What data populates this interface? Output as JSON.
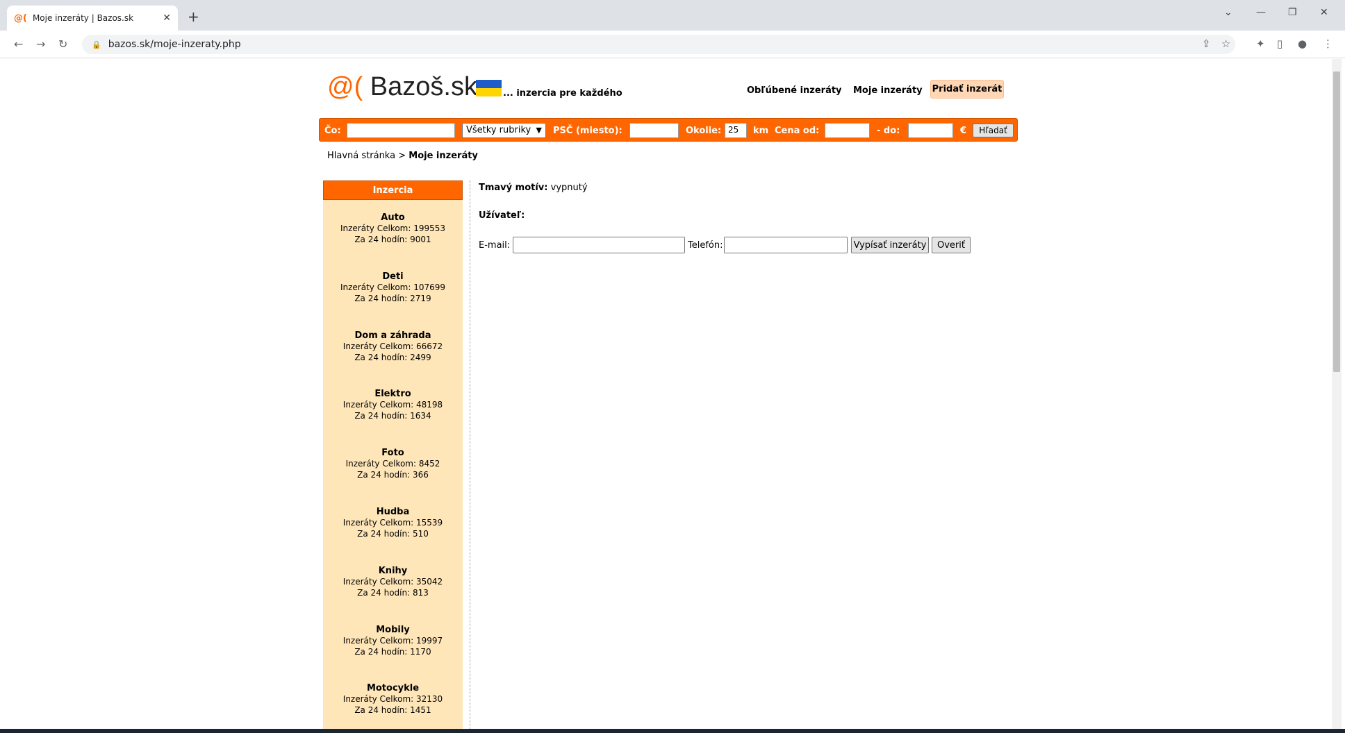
{
  "browser": {
    "tab_title": "Moje inzeráty | Bazos.sk",
    "tab_favicon": "@(",
    "url": "bazos.sk/moje-inzeraty.php"
  },
  "header": {
    "logo_at": "@(",
    "logo_name": " Bazoš.sk",
    "tagline": "... inzercia pre každého",
    "nav_favorites": "Obľúbené inzeráty",
    "nav_my_ads": "Moje inzeráty",
    "nav_add": "Pridať inzerát"
  },
  "search": {
    "what_label": "Čo:",
    "what_value": "",
    "category_selected": "Všetky rubriky",
    "psc_label": "PSČ (miesto):",
    "psc_value": "",
    "radius_label": "Okolie:",
    "radius_value": "25",
    "km_label": "km",
    "price_label": "Cena od:",
    "price_from": "",
    "dash_label": "- do:",
    "price_to": "",
    "currency": "€",
    "search_button": "Hľadať"
  },
  "breadcrumb": {
    "home": "Hlavná stránka",
    "separator": ">",
    "current": "Moje inzeráty"
  },
  "sidebar": {
    "header": "Inzercia",
    "categories": [
      {
        "name": "Auto",
        "total": "Inzeráty Celkom: 199553",
        "day": "Za 24 hodín: 9001"
      },
      {
        "name": "Deti",
        "total": "Inzeráty Celkom: 107699",
        "day": "Za 24 hodín: 2719"
      },
      {
        "name": "Dom a záhrada",
        "total": "Inzeráty Celkom: 66672",
        "day": "Za 24 hodín: 2499"
      },
      {
        "name": "Elektro",
        "total": "Inzeráty Celkom: 48198",
        "day": "Za 24 hodín: 1634"
      },
      {
        "name": "Foto",
        "total": "Inzeráty Celkom: 8452",
        "day": "Za 24 hodín: 366"
      },
      {
        "name": "Hudba",
        "total": "Inzeráty Celkom: 15539",
        "day": "Za 24 hodín: 510"
      },
      {
        "name": "Knihy",
        "total": "Inzeráty Celkom: 35042",
        "day": "Za 24 hodín: 813"
      },
      {
        "name": "Mobily",
        "total": "Inzeráty Celkom: 19997",
        "day": "Za 24 hodín: 1170"
      },
      {
        "name": "Motocykle",
        "total": "Inzeráty Celkom: 32130",
        "day": "Za 24 hodín: 1451"
      }
    ]
  },
  "main": {
    "theme_label": "Tmavý motív:",
    "theme_value": "vypnutý",
    "user_label": "Užívateľ:",
    "email_label": "E-mail:",
    "email_value": "",
    "phone_label": "Telefón:",
    "phone_value": "",
    "list_button": "Vypísať inzeráty",
    "verify_button": "Overiť"
  },
  "colors": {
    "brand_orange": "#ff6600",
    "sidebar_bg": "#ffe6b9",
    "add_button_bg": "#ffd7b5"
  }
}
